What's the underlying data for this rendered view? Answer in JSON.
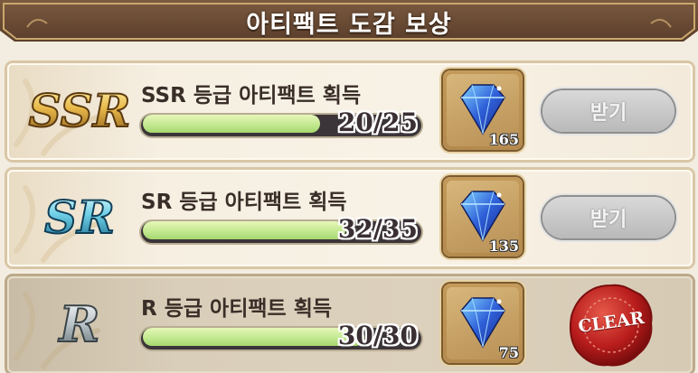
{
  "title": "아티팩트 도감 보상",
  "colors": {
    "header_bg": "#6a4a34",
    "bar_fill": "#c3e991",
    "bar_track": "#3b3438",
    "button_disabled": "#c4c4c4",
    "seal": "#b81c1c"
  },
  "rows": [
    {
      "rank_letters": "SSR",
      "rank_color": "gold",
      "label": "SSR 등급 아티팩트 획득",
      "progress_text": "20/25",
      "progress_current": 20,
      "progress_total": 25,
      "reward_icon": "diamond-gem-icon",
      "reward_qty": "165",
      "action_label": "받기",
      "state": "in-progress"
    },
    {
      "rank_letters": "SR",
      "rank_color": "cyan",
      "label": "SR 등급 아티팩트 획득",
      "progress_text": "32/35",
      "progress_current": 32,
      "progress_total": 35,
      "reward_icon": "diamond-gem-icon",
      "reward_qty": "135",
      "action_label": "받기",
      "state": "in-progress"
    },
    {
      "rank_letters": "R",
      "rank_color": "silver",
      "label": "R 등급 아티팩트 획득",
      "progress_text": "30/30",
      "progress_current": 30,
      "progress_total": 30,
      "reward_icon": "diamond-gem-icon",
      "reward_qty": "75",
      "action_label": "CLEAR",
      "state": "cleared"
    }
  ]
}
